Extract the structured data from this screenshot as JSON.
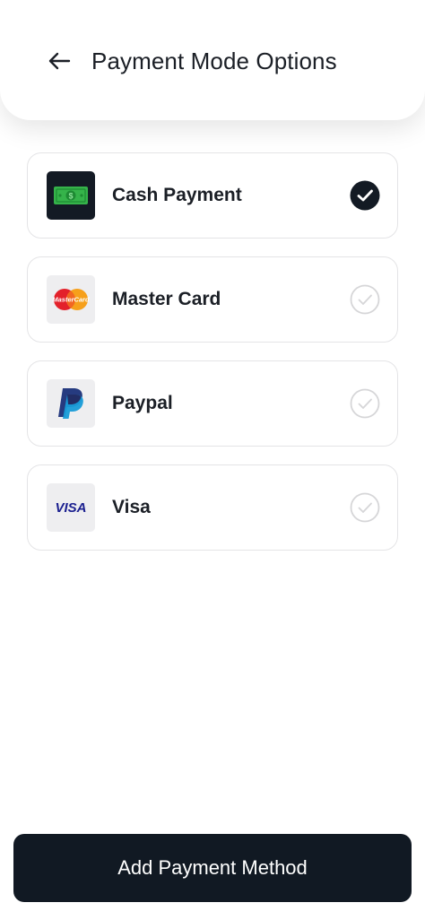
{
  "header": {
    "title": "Payment Mode Options"
  },
  "options": [
    {
      "label": "Cash Payment",
      "icon": "cash-icon",
      "selected": true
    },
    {
      "label": "Master Card",
      "icon": "mastercard-icon",
      "icon_text": "MasterCard",
      "selected": false
    },
    {
      "label": "Paypal",
      "icon": "paypal-icon",
      "selected": false
    },
    {
      "label": "Visa",
      "icon": "visa-icon",
      "icon_text": "VISA",
      "selected": false
    }
  ],
  "footer": {
    "add_label": "Add Payment Method"
  },
  "colors": {
    "primary_dark": "#111923",
    "selected_check": "#131a24",
    "unselected_check": "#d6d6d8",
    "cash_green": "#35b34a",
    "visa_blue": "#1a1f8f",
    "mastercard_red": "#e3212b",
    "mastercard_orange": "#f6a01b",
    "paypal_dark": "#263b80",
    "paypal_light": "#179bd7"
  }
}
